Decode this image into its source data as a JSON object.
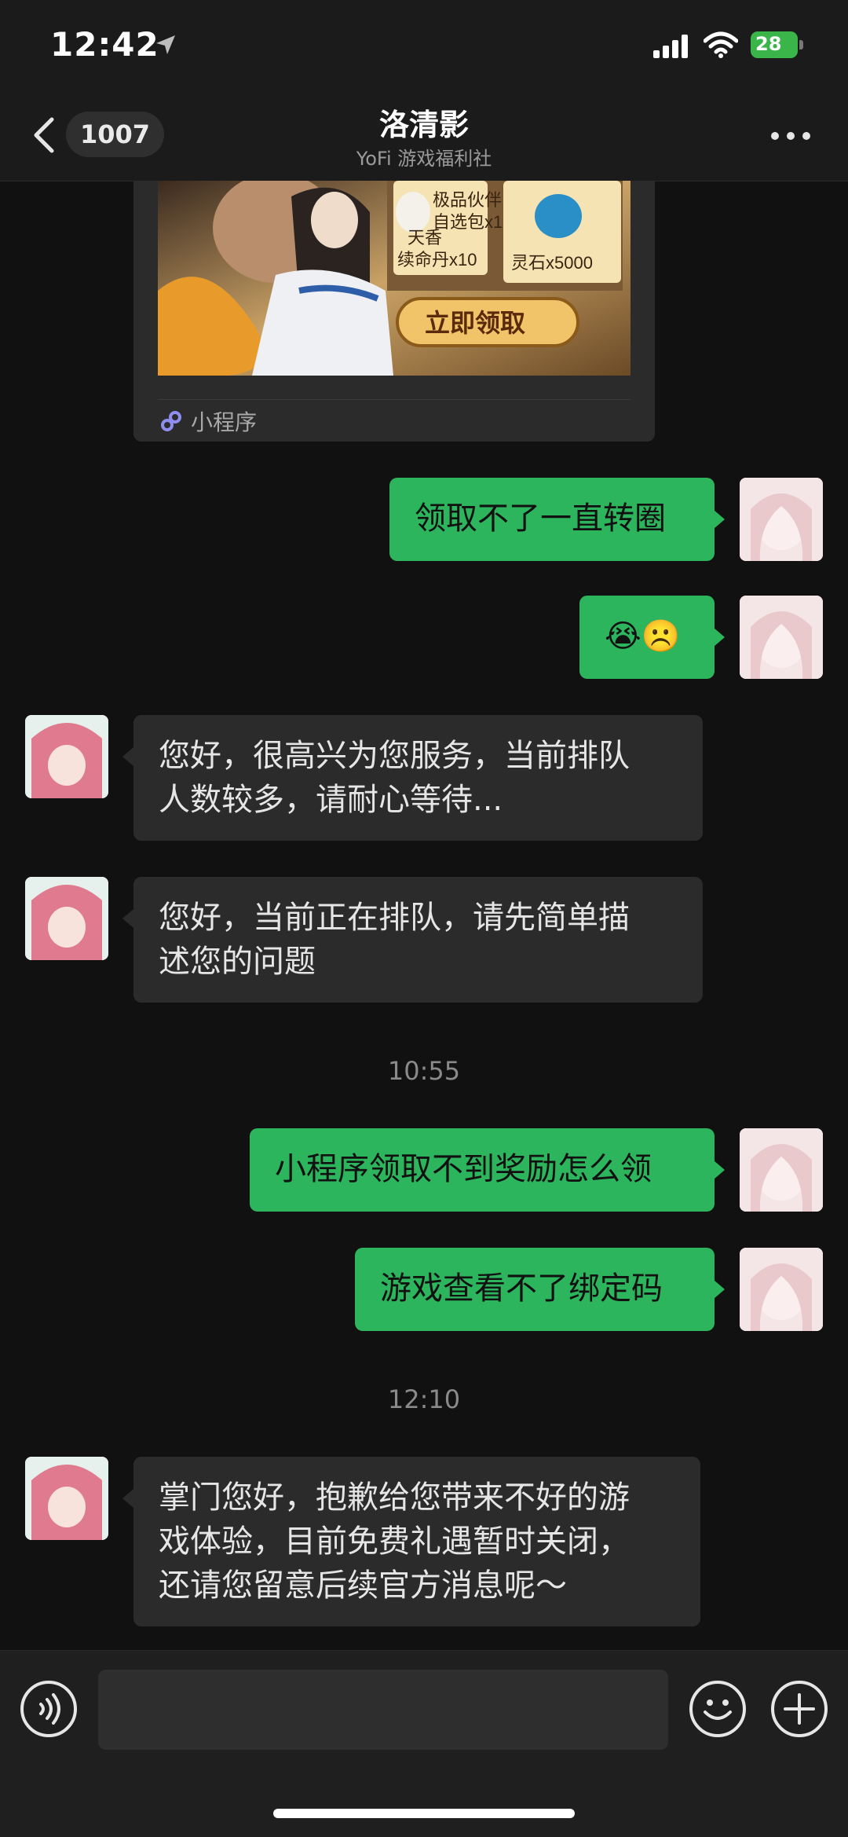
{
  "status_bar": {
    "time": "12:42",
    "battery": "28"
  },
  "nav": {
    "back_count": "1007",
    "title": "洛清影",
    "subtitle": "YoFi 游戏福利社"
  },
  "mini_program": {
    "label": "小程序",
    "image_texts": {
      "partner": "极品伙伴",
      "pack": "自选包x1",
      "potion_a": "天香",
      "potion_b": "续命丹x10",
      "stone": "灵石x5000",
      "claim": "立即领取"
    }
  },
  "messages": [
    {
      "from": "me",
      "text": "领取不了一直转圈"
    },
    {
      "from": "me",
      "emoji": "😭☹️"
    },
    {
      "from": "agent",
      "lines": [
        "您好，很高兴为您服务，当前排队",
        "人数较多，请耐心等待..."
      ]
    },
    {
      "from": "agent",
      "lines": [
        "您好，当前正在排队，请先简单描",
        "述您的问题"
      ]
    },
    {
      "timestamp": "10:55"
    },
    {
      "from": "me",
      "text": "小程序领取不到奖励怎么领"
    },
    {
      "from": "me",
      "text": "游戏查看不了绑定码"
    },
    {
      "timestamp": "12:10"
    },
    {
      "from": "agent",
      "lines": [
        "掌门您好，抱歉给您带来不好的游",
        "戏体验，目前免费礼遇暂时关闭，",
        "还请您留意后续官方消息呢～"
      ]
    }
  ],
  "colors": {
    "background": "#111111",
    "bubble_out": "#2db55d",
    "bubble_in": "#2b2b2b",
    "battery": "#3ab54a"
  },
  "icons": [
    "location-arrow-icon",
    "signal-icon",
    "wifi-icon",
    "battery-icon",
    "back-chevron-icon",
    "more-icon",
    "mini-program-icon",
    "voice-icon",
    "emoji-icon",
    "plus-icon"
  ]
}
